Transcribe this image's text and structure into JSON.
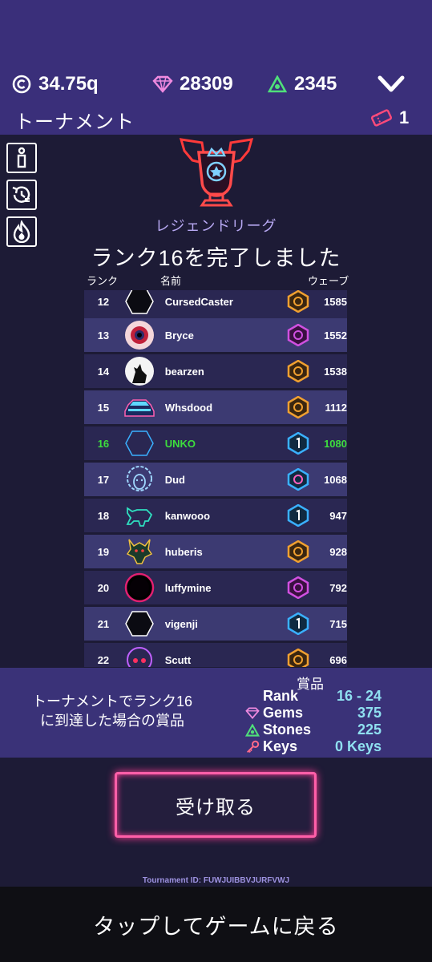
{
  "header": {
    "coins": "34.75q",
    "gems": "28309",
    "stones": "2345",
    "title": "トーナメント",
    "tickets": "1"
  },
  "league": "レジェンドリーグ",
  "finished": "ランク16を完了しました",
  "columns": {
    "rank": "ランク",
    "name": "名前",
    "wave": "ウェーブ"
  },
  "rows": [
    {
      "rank": "12",
      "name": "CursedCaster",
      "wave": "1585",
      "avatar": "hexagon-avatar",
      "badge": "orange"
    },
    {
      "rank": "13",
      "name": "Bryce",
      "wave": "1552",
      "avatar": "eye-avatar",
      "badge": "purple"
    },
    {
      "rank": "14",
      "name": "bearzen",
      "wave": "1538",
      "avatar": "wolf-avatar",
      "badge": "orange"
    },
    {
      "rank": "15",
      "name": "Whsdood",
      "wave": "1112",
      "avatar": "car-avatar",
      "badge": "orange"
    },
    {
      "rank": "16",
      "name": "UNKO",
      "wave": "1080",
      "avatar": "hexagon-outline-avatar",
      "badge": "blue"
    },
    {
      "rank": "17",
      "name": "Dud",
      "wave": "1068",
      "avatar": "sheep-avatar",
      "badge": "blue"
    },
    {
      "rank": "18",
      "name": "kanwooo",
      "wave": "947",
      "avatar": "bull-avatar",
      "badge": "blue"
    },
    {
      "rank": "19",
      "name": "huberis",
      "wave": "928",
      "avatar": "dragon-avatar",
      "badge": "orange"
    },
    {
      "rank": "20",
      "name": "luffymine",
      "wave": "792",
      "avatar": "blackhole-avatar",
      "badge": "purple"
    },
    {
      "rank": "21",
      "name": "vigenji",
      "wave": "715",
      "avatar": "hexagon-avatar",
      "badge": "blue"
    },
    {
      "rank": "22",
      "name": "Scutt",
      "wave": "696",
      "avatar": "skull-avatar",
      "badge": "orange"
    }
  ],
  "rewards": {
    "description_line1": "トーナメントでランク16",
    "description_line2": "に到達した場合の賞品",
    "header": "賞品",
    "rank_label": "Rank",
    "rank_value": "16 - 24",
    "gems_label": "Gems",
    "gems_value": "375",
    "stones_label": "Stones",
    "stones_value": "225",
    "keys_label": "Keys",
    "keys_value": "0 Keys"
  },
  "claim_label": "受け取る",
  "tournament_id": "Tournament ID: FUWJUIBBVJURFVWJ",
  "bottom_label": "タップしてゲームに戻る",
  "colors": {
    "topbar": "#3a2f7a",
    "highlight": "#3dde3d",
    "claim_border": "#ff5fa8"
  }
}
